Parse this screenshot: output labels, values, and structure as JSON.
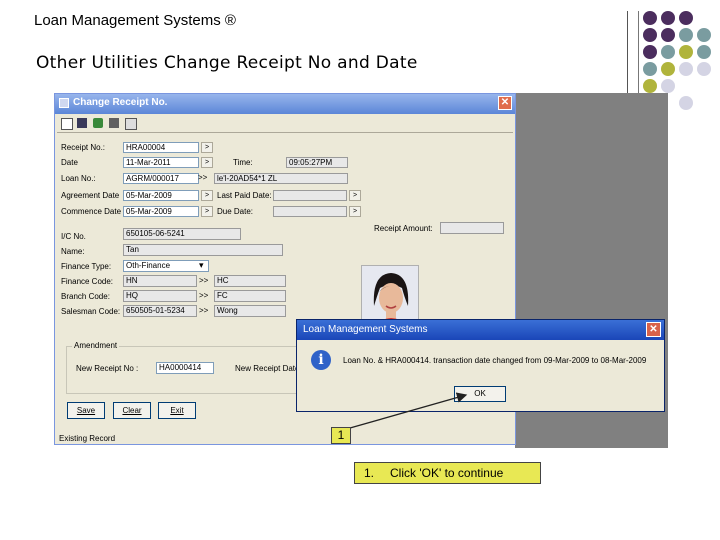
{
  "header": {
    "app_title": "Loan Management Systems ®"
  },
  "slide": {
    "subtitle": "Other Utilities Change Receipt No and Date"
  },
  "colors": {
    "dot_purple": "#4b2d5e",
    "dot_teal": "#7a9ca0",
    "dot_olive": "#b0b43c",
    "dot_lavender": "#d4d4e4",
    "highlight_yellow": "#e8e854"
  },
  "window": {
    "title": "Change Receipt No.",
    "toolbar_icons": [
      "new-icon",
      "save-icon",
      "edit-icon",
      "print-icon",
      "exit-icon"
    ],
    "close_glyph": "✕"
  },
  "form": {
    "receipt_no": {
      "label": "Receipt No.:",
      "value": "HRA00004"
    },
    "date": {
      "label": "Date",
      "value": "11-Mar-2011"
    },
    "time": {
      "label": "Time:",
      "value": "09:05:27PM"
    },
    "loan_no": {
      "label": "Loan No.:",
      "value": "AGRM/000017",
      "value2": "le'l-20AD54*1 ZL"
    },
    "agreement_date": {
      "label": "Agreement Date",
      "value": "05-Mar-2009"
    },
    "last_paid_date": {
      "label": "Last Paid Date:",
      "value": ""
    },
    "commence_date": {
      "label": "Commence Date",
      "value": "05-Mar-2009"
    },
    "due_date": {
      "label": "Due Date:",
      "value": ""
    },
    "receipt_amount": {
      "label": "Receipt Amount:",
      "value": ""
    },
    "ic_no": {
      "label": "I/C No.",
      "value": "650105-06-5241"
    },
    "name": {
      "label": "Name:",
      "value": "Tan"
    },
    "finance_type": {
      "label": "Finance Type:",
      "value": "Oth-Finance"
    },
    "finance_code": {
      "label": "Finance Code:",
      "value": "HN",
      "desc": "HC"
    },
    "branch_code": {
      "label": "Branch Code:",
      "value": "HQ",
      "desc": "FC"
    },
    "salesman_code": {
      "label": "Salesman Code:",
      "value": "650505-01-5234",
      "desc": "Wong"
    },
    "amendment": {
      "legend": "Amendment",
      "new_receipt_label": "New Receipt No :",
      "new_receipt_value": "HA0000414",
      "new_receipt_date_label": "New Receipt Date"
    },
    "buttons": {
      "save": "Save",
      "clear": "Clear",
      "exit": "Exit"
    },
    "status_text": "Existing Record",
    "lookup_glyph": ">",
    "lookup_glyph2": ">>",
    "dropdown_glyph": "▾"
  },
  "dialog": {
    "title": "Loan Management Systems",
    "message": "Loan No. & HRA000414. transaction date changed from 09-Mar-2009 to 08-Mar-2009",
    "ok_label": "OK",
    "info_glyph": "i",
    "close_glyph": "✕"
  },
  "annotation": {
    "marker": "1",
    "step_number": "1.",
    "step_text": "Click 'OK' to continue"
  }
}
